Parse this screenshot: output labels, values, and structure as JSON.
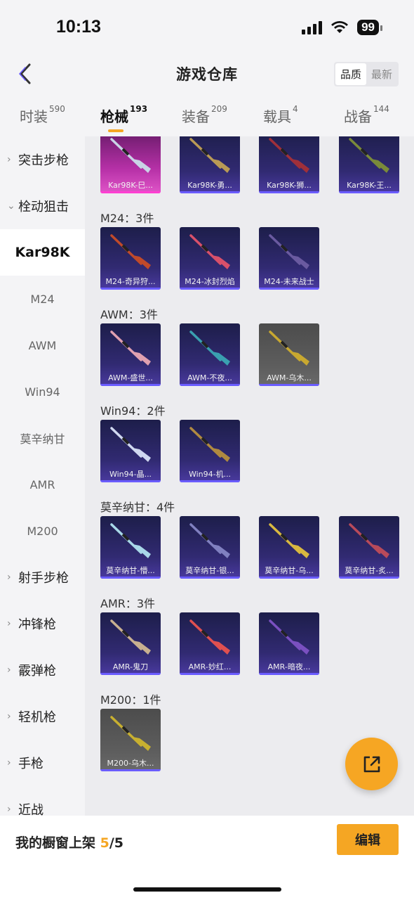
{
  "status_bar": {
    "time": "10:13",
    "battery": "99"
  },
  "header": {
    "title": "游戏仓库",
    "sort_options": [
      "品质",
      "最新"
    ]
  },
  "tabs": [
    {
      "label": "时装",
      "count": "590"
    },
    {
      "label": "枪械",
      "count": "193"
    },
    {
      "label": "装备",
      "count": "209"
    },
    {
      "label": "载具",
      "count": "4"
    },
    {
      "label": "战备",
      "count": "144"
    }
  ],
  "sidebar": {
    "items": [
      {
        "label": "突击步枪",
        "kind": "category",
        "chevron": "›"
      },
      {
        "label": "栓动狙击",
        "kind": "category",
        "chevron": "⌄"
      },
      {
        "label": "Kar98K",
        "kind": "selected"
      },
      {
        "label": "M24",
        "kind": "sub"
      },
      {
        "label": "AWM",
        "kind": "sub"
      },
      {
        "label": "Win94",
        "kind": "sub"
      },
      {
        "label": "莫辛纳甘",
        "kind": "sub"
      },
      {
        "label": "AMR",
        "kind": "sub"
      },
      {
        "label": "M200",
        "kind": "sub"
      },
      {
        "label": "射手步枪",
        "kind": "category",
        "chevron": "›"
      },
      {
        "label": "冲锋枪",
        "kind": "category",
        "chevron": "›"
      },
      {
        "label": "霰弹枪",
        "kind": "category",
        "chevron": "›"
      },
      {
        "label": "轻机枪",
        "kind": "category",
        "chevron": "›"
      },
      {
        "label": "手枪",
        "kind": "category",
        "chevron": "›"
      },
      {
        "label": "近战",
        "kind": "category",
        "chevron": "›"
      }
    ]
  },
  "groups": [
    {
      "title": "",
      "items": [
        {
          "name": "Kar98K-巳...",
          "style": "pink",
          "gun": "#c9d3e6"
        },
        {
          "name": "Kar98K-勇...",
          "style": "blue",
          "gun": "#b99a55"
        },
        {
          "name": "Kar98K-狮...",
          "style": "blue",
          "gun": "#a0303a"
        },
        {
          "name": "Kar98K-王...",
          "style": "blue",
          "gun": "#7a8a3a"
        }
      ]
    },
    {
      "title": "M24：3件",
      "items": [
        {
          "name": "M24-奇异狩...",
          "style": "blue",
          "gun": "#c04a2a"
        },
        {
          "name": "M24-冰封烈焰",
          "style": "blue",
          "gun": "#d8506a"
        },
        {
          "name": "M24-未来战士",
          "style": "blue",
          "gun": "#6a5aa0"
        }
      ]
    },
    {
      "title": "AWM：3件",
      "items": [
        {
          "name": "AWM-盛世...",
          "style": "blue",
          "gun": "#e0a0b0"
        },
        {
          "name": "AWM-不夜...",
          "style": "blue",
          "gun": "#3aa0b0"
        },
        {
          "name": "AWM-乌木...",
          "style": "gray",
          "gun": "#c8a830"
        }
      ]
    },
    {
      "title": "Win94：2件",
      "items": [
        {
          "name": "Win94-晶...",
          "style": "blue",
          "gun": "#d0d8f0"
        },
        {
          "name": "Win94-机...",
          "style": "blue",
          "gun": "#b08a40"
        }
      ]
    },
    {
      "title": "莫辛纳甘：4件",
      "items": [
        {
          "name": "莫辛纳甘-懵...",
          "style": "blue",
          "gun": "#a8d8e8"
        },
        {
          "name": "莫辛纳甘-银...",
          "style": "blue",
          "gun": "#8080c0"
        },
        {
          "name": "莫辛纳甘-乌...",
          "style": "blue",
          "gun": "#d8b840"
        },
        {
          "name": "莫辛纳甘-炙...",
          "style": "blue",
          "gun": "#b84a5a"
        }
      ]
    },
    {
      "title": "AMR：3件",
      "items": [
        {
          "name": "AMR-鬼刀",
          "style": "blue",
          "gun": "#c8b090"
        },
        {
          "name": "AMR-妙红...",
          "style": "blue",
          "gun": "#e05050"
        },
        {
          "name": "AMR-暗夜...",
          "style": "blue",
          "gun": "#7a50c0"
        }
      ]
    },
    {
      "title": "M200：1件",
      "items": [
        {
          "name": "M200-乌木...",
          "style": "gray",
          "gun": "#c8b030"
        }
      ]
    }
  ],
  "bottom": {
    "label_prefix": "我的橱窗上架 ",
    "count": "5",
    "total": "/5",
    "edit_label": "编辑"
  },
  "icons": {
    "back": "chevron-left-icon",
    "share": "share-icon"
  },
  "colors": {
    "accent": "#f5a623",
    "card_blue": "#312a72",
    "card_pink": "#b530a6"
  }
}
